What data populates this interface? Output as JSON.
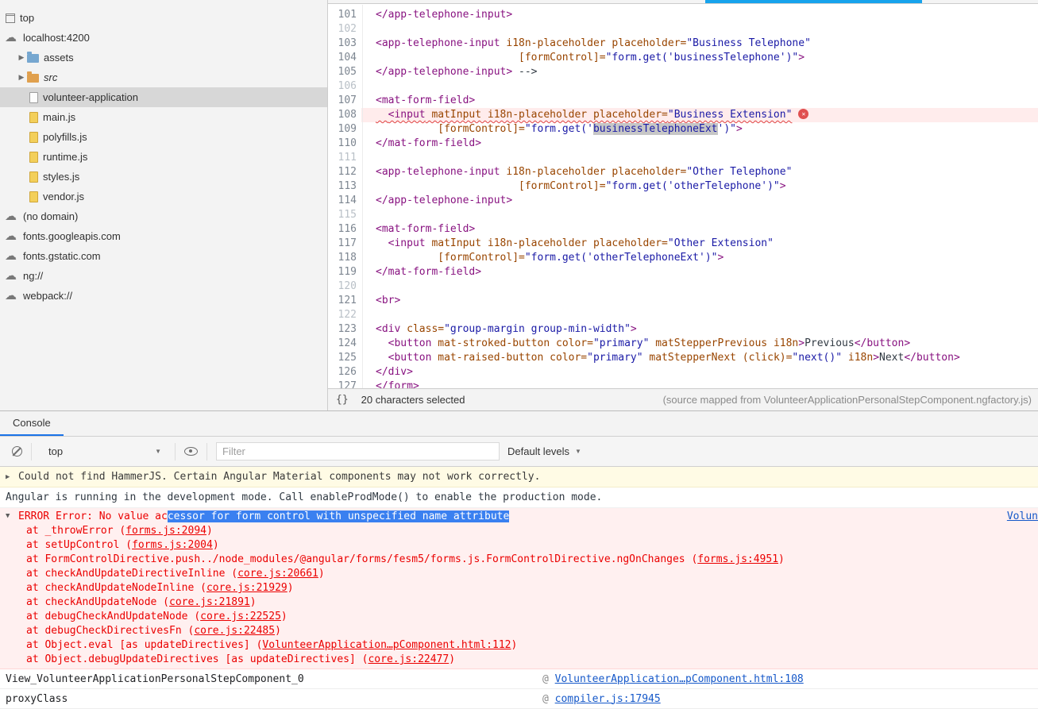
{
  "colors": {
    "error_text": "#eb0000",
    "error_bg": "#fff0f0",
    "error_line_bg": "#ffecec",
    "warning_bg": "#fffbe5",
    "selection_blue": "#3a80f0",
    "link_blue": "#1558c9",
    "tab_accent": "#1a73e8",
    "top_bar_blue": "#17a3ec",
    "code_tag": "#881280",
    "code_attr": "#994500",
    "code_value": "#1a1aa6",
    "folder_blue": "#76a7d0",
    "folder_orange": "#e0a04e"
  },
  "sidebar": {
    "items": [
      {
        "label": "top",
        "icon": "frame-icon",
        "indent": 0
      },
      {
        "label": "localhost:4200",
        "icon": "cloud-icon",
        "indent": 1
      },
      {
        "label": "assets",
        "icon": "folder-icon-blue",
        "indent": 2,
        "arrow": "▶"
      },
      {
        "label": "src",
        "icon": "folder-icon-orange",
        "indent": 2,
        "arrow": "▶",
        "italic": true
      },
      {
        "label": "volunteer-application",
        "icon": "file-icon-plain",
        "indent": 2,
        "selected": true
      },
      {
        "label": "main.js",
        "icon": "file-icon-js",
        "indent": 2
      },
      {
        "label": "polyfills.js",
        "icon": "file-icon-js",
        "indent": 2
      },
      {
        "label": "runtime.js",
        "icon": "file-icon-js",
        "indent": 2
      },
      {
        "label": "styles.js",
        "icon": "file-icon-js",
        "indent": 2
      },
      {
        "label": "vendor.js",
        "icon": "file-icon-js",
        "indent": 2
      },
      {
        "label": "(no domain)",
        "icon": "cloud-icon",
        "indent": 1
      },
      {
        "label": "fonts.googleapis.com",
        "icon": "cloud-icon",
        "indent": 1
      },
      {
        "label": "fonts.gstatic.com",
        "icon": "cloud-icon",
        "indent": 1
      },
      {
        "label": "ng://",
        "icon": "cloud-icon",
        "indent": 1
      },
      {
        "label": "webpack://",
        "icon": "cloud-icon",
        "indent": 1
      }
    ]
  },
  "editor": {
    "lines": [
      {
        "no": "101",
        "segs": [
          [
            "tag",
            "</app-telephone-input>"
          ]
        ]
      },
      {
        "no": "102",
        "segs": []
      },
      {
        "no": "103",
        "segs": [
          [
            "tag",
            "<app-telephone-input"
          ],
          [
            "attr",
            " i18n-placeholder placeholder="
          ],
          [
            "val",
            "\"Business Telephone\""
          ]
        ]
      },
      {
        "no": "104",
        "segs": [
          [
            "plain",
            "                       "
          ],
          [
            "attr",
            "[formControl]="
          ],
          [
            "val",
            "\"form.get('businessTelephone')\""
          ],
          [
            "tag",
            ">"
          ]
        ]
      },
      {
        "no": "105",
        "segs": [
          [
            "tag",
            "</app-telephone-input>"
          ],
          [
            "plain",
            " -->"
          ]
        ]
      },
      {
        "no": "106",
        "segs": []
      },
      {
        "no": "107",
        "segs": [
          [
            "tag",
            "<mat-form-field>"
          ]
        ]
      },
      {
        "no": "108",
        "error": true,
        "segs": [
          [
            "plain",
            "  "
          ],
          [
            "tag",
            "<input"
          ],
          [
            "attr",
            " matInput i18n-placeholder placeholder="
          ],
          [
            "val",
            "\"Business Extension\""
          ]
        ]
      },
      {
        "no": "109",
        "segs": [
          [
            "plain",
            "          "
          ],
          [
            "attr",
            "[formControl]="
          ],
          [
            "val",
            "\"form.get('"
          ],
          [
            "vsel",
            "businessTelephoneExt"
          ],
          [
            "val",
            "')\""
          ],
          [
            "tag",
            ">"
          ]
        ]
      },
      {
        "no": "110",
        "segs": [
          [
            "tag",
            "</mat-form-field>"
          ]
        ]
      },
      {
        "no": "111",
        "segs": []
      },
      {
        "no": "112",
        "segs": [
          [
            "tag",
            "<app-telephone-input"
          ],
          [
            "attr",
            " i18n-placeholder placeholder="
          ],
          [
            "val",
            "\"Other Telephone\""
          ]
        ]
      },
      {
        "no": "113",
        "segs": [
          [
            "plain",
            "                       "
          ],
          [
            "attr",
            "[formControl]="
          ],
          [
            "val",
            "\"form.get('otherTelephone')\""
          ],
          [
            "tag",
            ">"
          ]
        ]
      },
      {
        "no": "114",
        "segs": [
          [
            "tag",
            "</app-telephone-input>"
          ]
        ]
      },
      {
        "no": "115",
        "segs": []
      },
      {
        "no": "116",
        "segs": [
          [
            "tag",
            "<mat-form-field>"
          ]
        ]
      },
      {
        "no": "117",
        "segs": [
          [
            "plain",
            "  "
          ],
          [
            "tag",
            "<input"
          ],
          [
            "attr",
            " matInput i18n-placeholder placeholder="
          ],
          [
            "val",
            "\"Other Extension\""
          ]
        ]
      },
      {
        "no": "118",
        "segs": [
          [
            "plain",
            "          "
          ],
          [
            "attr",
            "[formControl]="
          ],
          [
            "val",
            "\"form.get('otherTelephoneExt')\""
          ],
          [
            "tag",
            ">"
          ]
        ]
      },
      {
        "no": "119",
        "segs": [
          [
            "tag",
            "</mat-form-field>"
          ]
        ]
      },
      {
        "no": "120",
        "segs": []
      },
      {
        "no": "121",
        "segs": [
          [
            "tag",
            "<br>"
          ]
        ]
      },
      {
        "no": "122",
        "segs": []
      },
      {
        "no": "123",
        "segs": [
          [
            "tag",
            "<div"
          ],
          [
            "attr",
            " class="
          ],
          [
            "val",
            "\"group-margin group-min-width\""
          ],
          [
            "tag",
            ">"
          ]
        ]
      },
      {
        "no": "124",
        "segs": [
          [
            "plain",
            "  "
          ],
          [
            "tag",
            "<button"
          ],
          [
            "attr",
            " mat-stroked-button color="
          ],
          [
            "val",
            "\"primary\""
          ],
          [
            "attr",
            " matStepperPrevious i18n"
          ],
          [
            "tag",
            ">"
          ],
          [
            "plain",
            "Previous"
          ],
          [
            "tag",
            "</button>"
          ]
        ]
      },
      {
        "no": "125",
        "segs": [
          [
            "plain",
            "  "
          ],
          [
            "tag",
            "<button"
          ],
          [
            "attr",
            " mat-raised-button color="
          ],
          [
            "val",
            "\"primary\""
          ],
          [
            "attr",
            " matStepperNext (click)="
          ],
          [
            "val",
            "\"next()\""
          ],
          [
            "attr",
            " i18n"
          ],
          [
            "tag",
            ">"
          ],
          [
            "plain",
            "Next"
          ],
          [
            "tag",
            "</button>"
          ]
        ]
      },
      {
        "no": "126",
        "segs": [
          [
            "tag",
            "</div>"
          ]
        ]
      },
      {
        "no": "127",
        "segs": [
          [
            "tag",
            "</form>"
          ]
        ]
      }
    ]
  },
  "statusbar": {
    "brace_icon": "{}",
    "left": "20 characters selected",
    "right": "(source mapped from VolunteerApplicationPersonalStepComponent.ngfactory.js)"
  },
  "console": {
    "tab_label": "Console",
    "toolbar": {
      "context_value": "top",
      "filter_placeholder": "Filter",
      "levels_label": "Default levels",
      "chevron": "▼"
    },
    "warning": {
      "arrow": "▶",
      "text": "Could not find HammerJS. Certain Angular Material components may not work correctly."
    },
    "log": {
      "text": "Angular is running in the development mode. Call enableProdMode() to enable the production mode."
    },
    "error": {
      "arrow": "▼",
      "msg_plain": "ERROR Error: No value ac",
      "msg_selected": "cessor for form control with unspecified name attribute",
      "source_link": "Volun",
      "stack": [
        {
          "fn": "at _throwError (",
          "link": "forms.js:2094",
          "close": ")"
        },
        {
          "fn": "at setUpControl (",
          "link": "forms.js:2004",
          "close": ")"
        },
        {
          "fn": "at FormControlDirective.push../node_modules/@angular/forms/fesm5/forms.js.FormControlDirective.ngOnChanges (",
          "link": "forms.js:4951",
          "close": ")"
        },
        {
          "fn": "at checkAndUpdateDirectiveInline (",
          "link": "core.js:20661",
          "close": ")"
        },
        {
          "fn": "at checkAndUpdateNodeInline (",
          "link": "core.js:21929",
          "close": ")"
        },
        {
          "fn": "at checkAndUpdateNode (",
          "link": "core.js:21891",
          "close": ")"
        },
        {
          "fn": "at debugCheckAndUpdateNode (",
          "link": "core.js:22525",
          "close": ")"
        },
        {
          "fn": "at debugCheckDirectivesFn (",
          "link": "core.js:22485",
          "close": ")"
        },
        {
          "fn": "at Object.eval [as updateDirectives] (",
          "link": "VolunteerApplication…pComponent.html:112",
          "close": ")"
        },
        {
          "fn": "at Object.debugUpdateDirectives [as updateDirectives] (",
          "link": "core.js:22477",
          "close": ")"
        }
      ]
    },
    "frames": [
      {
        "name": "View_VolunteerApplicationPersonalStepComponent_0",
        "at": "@",
        "link": "VolunteerApplication…pComponent.html:108"
      },
      {
        "name": "proxyClass",
        "at": "@",
        "link": "compiler.js:17945"
      }
    ]
  }
}
